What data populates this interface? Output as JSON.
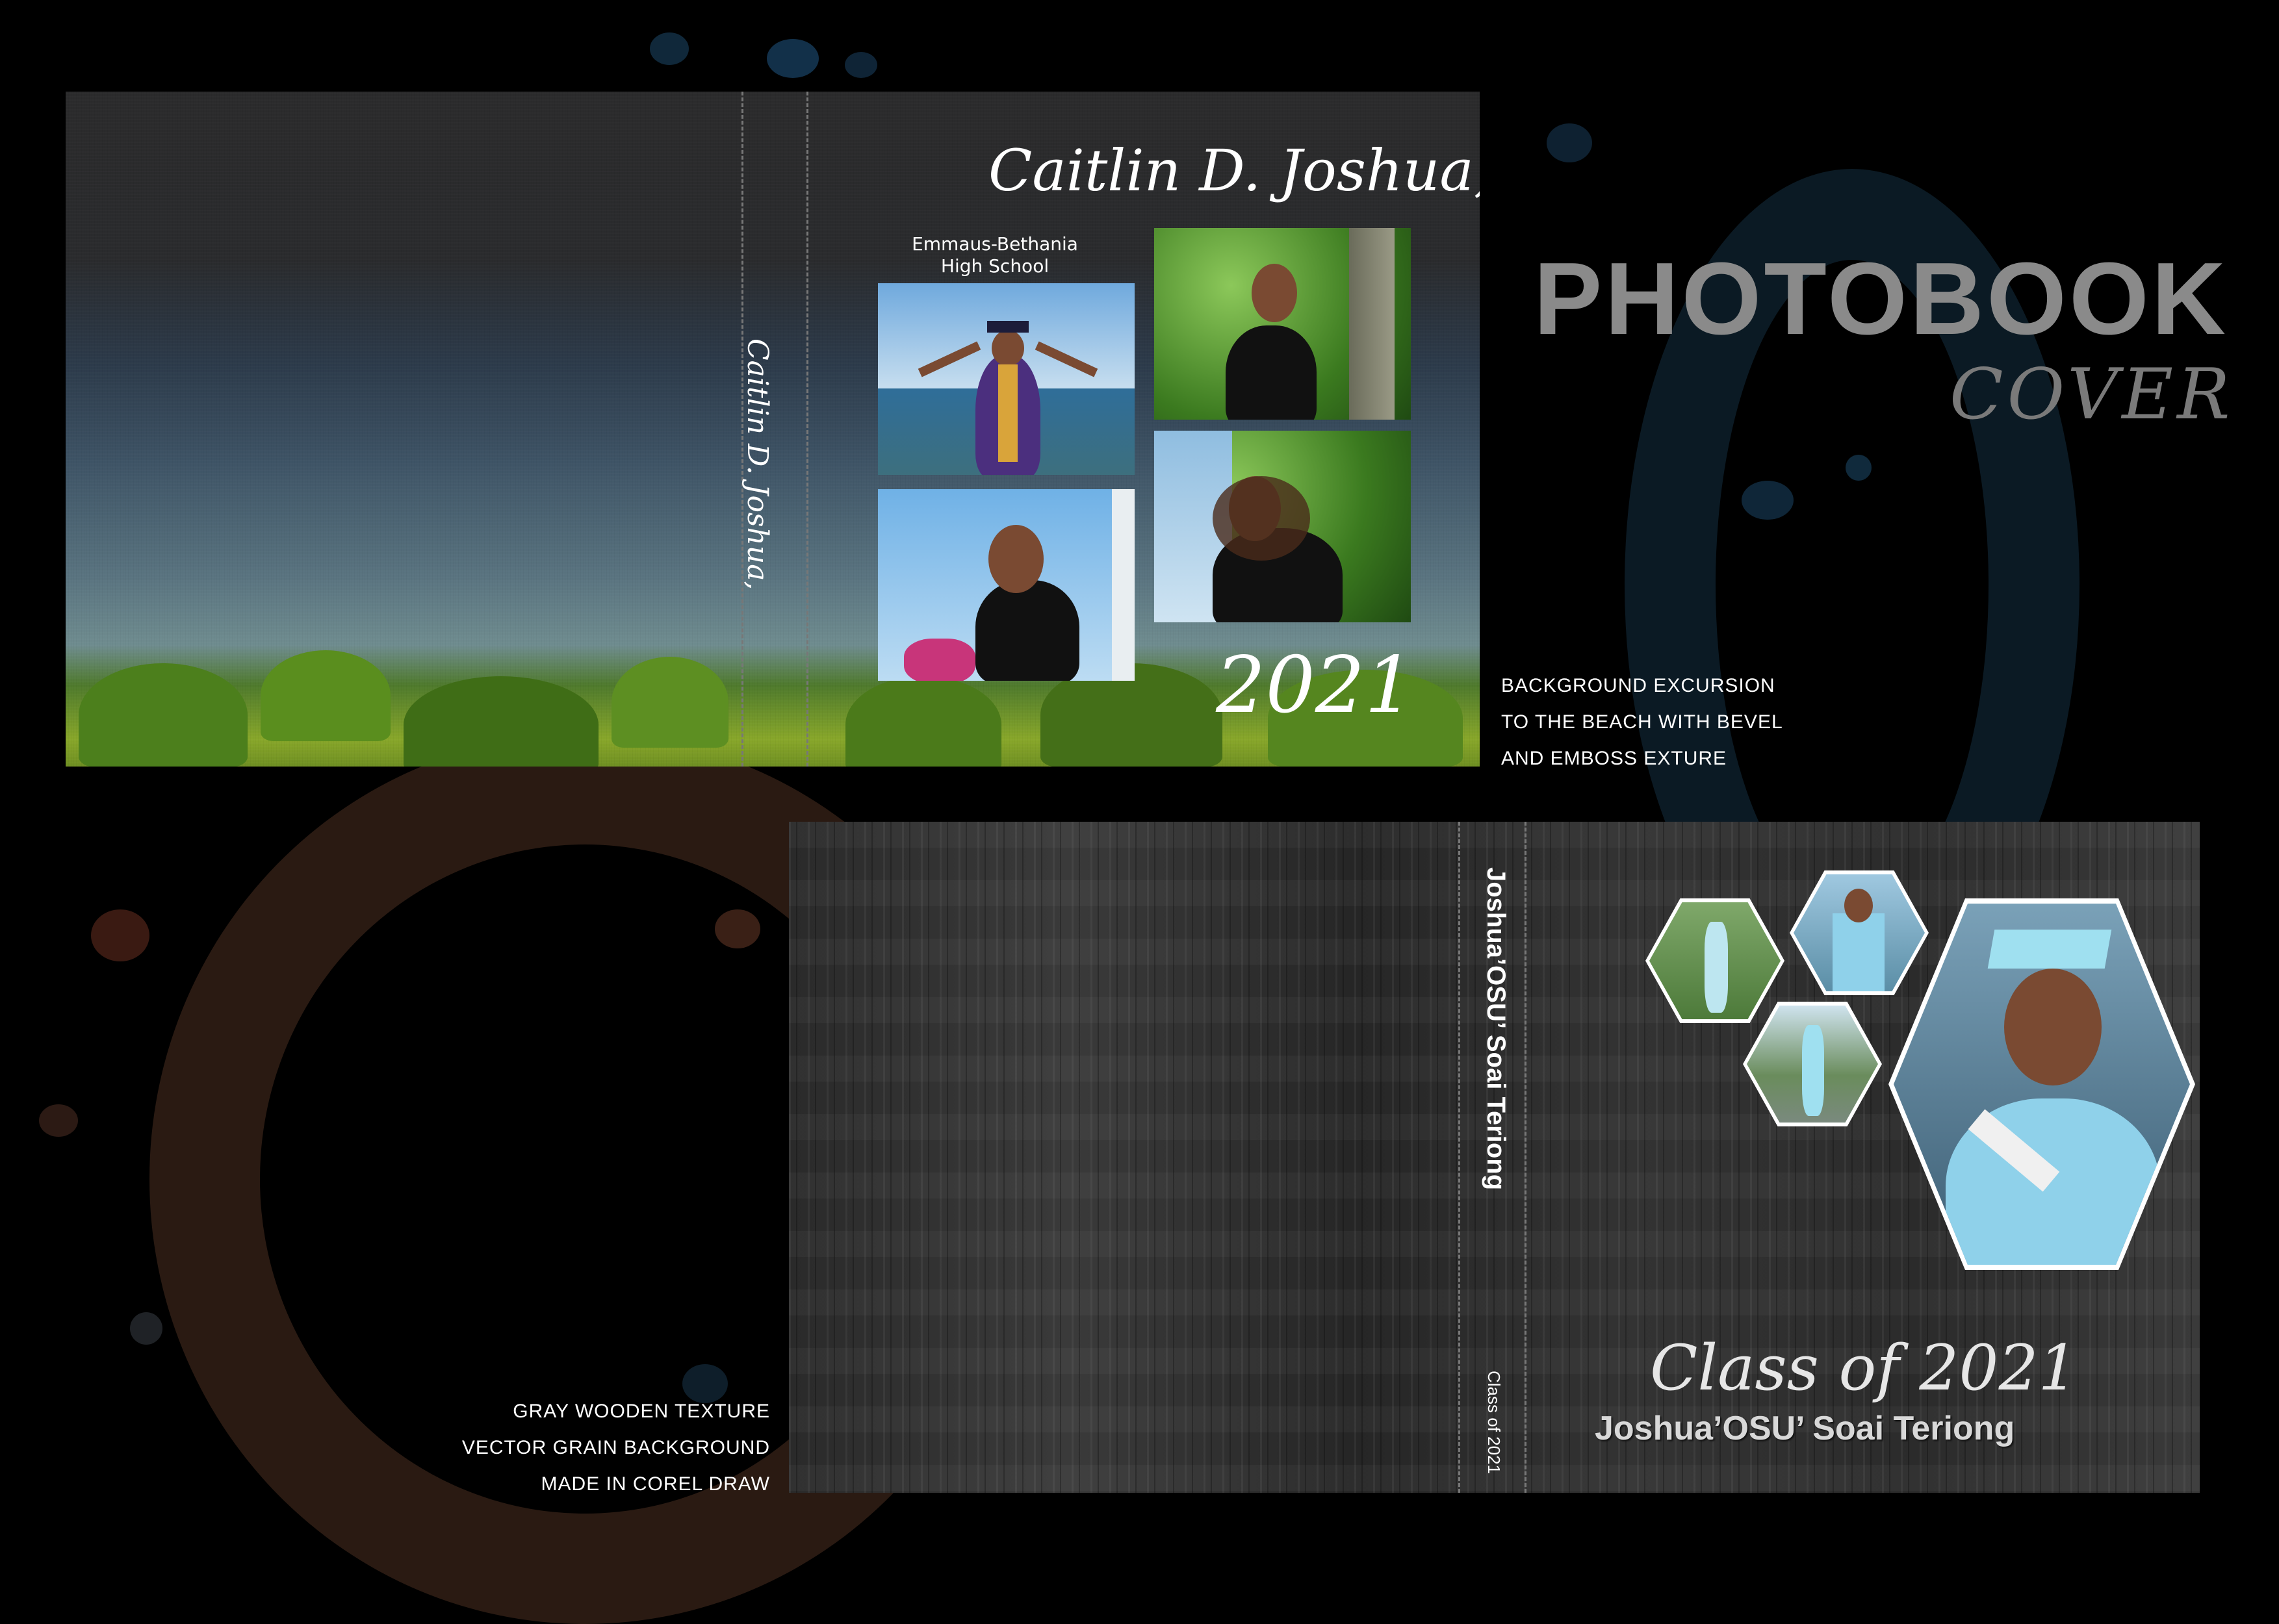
{
  "top_cover": {
    "name": "Caitlin D. Joshua,",
    "school_line1": "Emmaus-Bethania",
    "school_line2": "High School",
    "spine_name": "Caitlin D. Joshua,",
    "year": "2021"
  },
  "heading": {
    "title": "PHOTOBOOK",
    "subtitle": "COVER"
  },
  "note_top": {
    "line1": "BACKGROUND EXCURSION",
    "line2": "TO THE BEACH WITH BEVEL",
    "line3": "AND EMBOSS EXTURE"
  },
  "note_bottom": {
    "line1": "GRAY WOODEN TEXTURE",
    "line2": "VECTOR GRAIN BACKGROUND",
    "line3": "MADE IN COREL DRAW"
  },
  "bottom_cover": {
    "spine_name": "Joshua’OSU’ Soai Teriong",
    "spine_class": "Class of 2021",
    "class_script": "Class of 2021",
    "name": "Joshua’OSU’ Soai Teriong"
  },
  "colors": {
    "heading_gray": "#8a8a8a",
    "gown_blue": "#8fd1ea",
    "gown_purple": "#4b2f7e"
  }
}
